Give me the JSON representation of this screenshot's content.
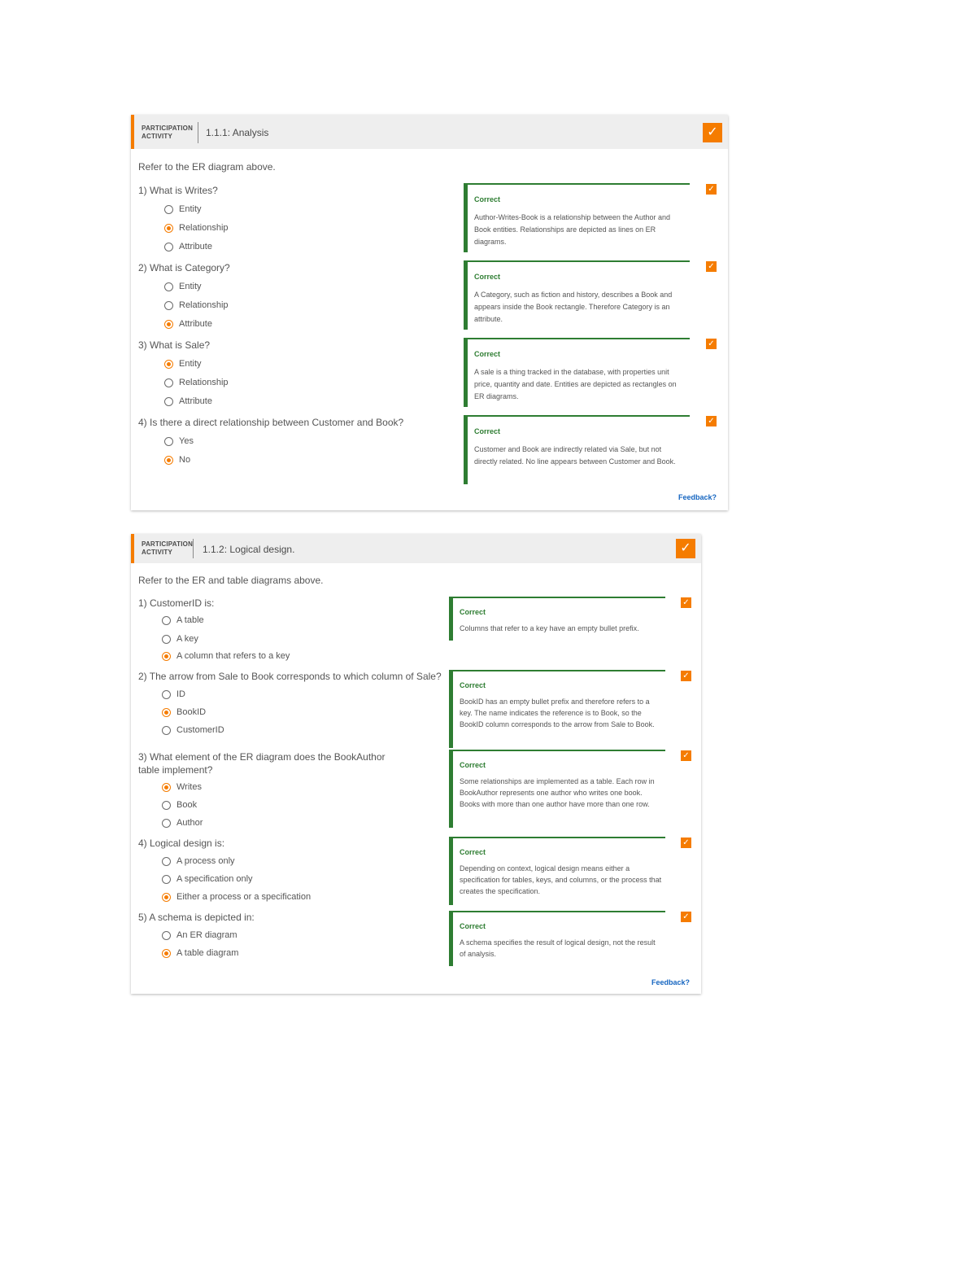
{
  "activity1": {
    "label_line1": "PARTICIPATION",
    "label_line2": "ACTIVITY",
    "title": "1.1.1: Analysis",
    "intro": "Refer to the ER diagram above.",
    "feedback_link": "Feedback?",
    "questions": [
      {
        "text": "1)  What is Writes?",
        "options": [
          {
            "label": "Entity",
            "selected": false
          },
          {
            "label": "Relationship",
            "selected": true
          },
          {
            "label": "Attribute",
            "selected": false
          }
        ],
        "feedback_title": "Correct",
        "feedback_text": "Author-Writes-Book is a relationship between the Author and Book entities. Relationships are depicted as lines on ER diagrams."
      },
      {
        "text": "2)  What is Category?",
        "options": [
          {
            "label": "Entity",
            "selected": false
          },
          {
            "label": "Relationship",
            "selected": false
          },
          {
            "label": "Attribute",
            "selected": true
          }
        ],
        "feedback_title": "Correct",
        "feedback_text": "A Category, such as fiction and history, describes a Book and appears inside the Book rectangle. Therefore Category is an attribute."
      },
      {
        "text": "3)  What is Sale?",
        "options": [
          {
            "label": "Entity",
            "selected": true
          },
          {
            "label": "Relationship",
            "selected": false
          },
          {
            "label": "Attribute",
            "selected": false
          }
        ],
        "feedback_title": "Correct",
        "feedback_text": "A sale is a thing tracked in the database, with properties unit price, quantity and date. Entities are depicted as rectangles on ER diagrams."
      },
      {
        "text": "4)  Is there a direct relationship between Customer and Book?",
        "options": [
          {
            "label": "Yes",
            "selected": false
          },
          {
            "label": "No",
            "selected": true
          }
        ],
        "feedback_title": "Correct",
        "feedback_text": "Customer and Book are indirectly related via Sale, but not directly related. No line appears between Customer and Book."
      }
    ]
  },
  "activity2": {
    "label_line1": "PARTICIPATION",
    "label_line2": "ACTIVITY",
    "title": "1.1.2: Logical design.",
    "intro": "Refer to the ER and table diagrams above.",
    "feedback_link": "Feedback?",
    "questions": [
      {
        "text": "1)  CustomerID is:",
        "options": [
          {
            "label": "A table",
            "selected": false
          },
          {
            "label": "A key",
            "selected": false
          },
          {
            "label": "A column that refers to a key",
            "selected": true
          }
        ],
        "feedback_title": "Correct",
        "feedback_text": "Columns that refer to a key have an empty bullet prefix."
      },
      {
        "text": "2)  The arrow from Sale to Book corresponds to which column of Sale?",
        "options": [
          {
            "label": "ID",
            "selected": false
          },
          {
            "label": "BookID",
            "selected": true
          },
          {
            "label": "CustomerID",
            "selected": false
          }
        ],
        "feedback_title": "Correct",
        "feedback_text": "BookID has an empty bullet prefix and therefore refers to a key. The name indicates the reference is to Book, so the BookID column corresponds to the arrow from Sale to Book."
      },
      {
        "text": "3)  What element of the ER diagram does the BookAuthor table implement?",
        "options": [
          {
            "label": "Writes",
            "selected": true
          },
          {
            "label": "Book",
            "selected": false
          },
          {
            "label": "Author",
            "selected": false
          }
        ],
        "feedback_title": "Correct",
        "feedback_text": "Some relationships are implemented as a table. Each row in BookAuthor represents one author who writes one book. Books with more than one author have more than one row."
      },
      {
        "text": "4)  Logical design is:",
        "options": [
          {
            "label": "A process only",
            "selected": false
          },
          {
            "label": "A specification only",
            "selected": false
          },
          {
            "label": "Either a process or a specification",
            "selected": true
          }
        ],
        "feedback_title": "Correct",
        "feedback_text": "Depending on context, logical design means either a specification for tables, keys, and columns, or the process that creates the specification."
      },
      {
        "text": "5)  A schema is depicted in:",
        "options": [
          {
            "label": "An ER diagram",
            "selected": false
          },
          {
            "label": "A table diagram",
            "selected": true
          }
        ],
        "feedback_title": "Correct",
        "feedback_text": "A schema specifies the result of logical design, not the result of analysis."
      }
    ]
  },
  "colors": {
    "accent": "#f57c00",
    "correct": "#2e7d32",
    "link": "#1565c0",
    "header_bg": "#eeeeee"
  },
  "icons": {
    "completion": "check-icon",
    "option": "radio-icon"
  }
}
